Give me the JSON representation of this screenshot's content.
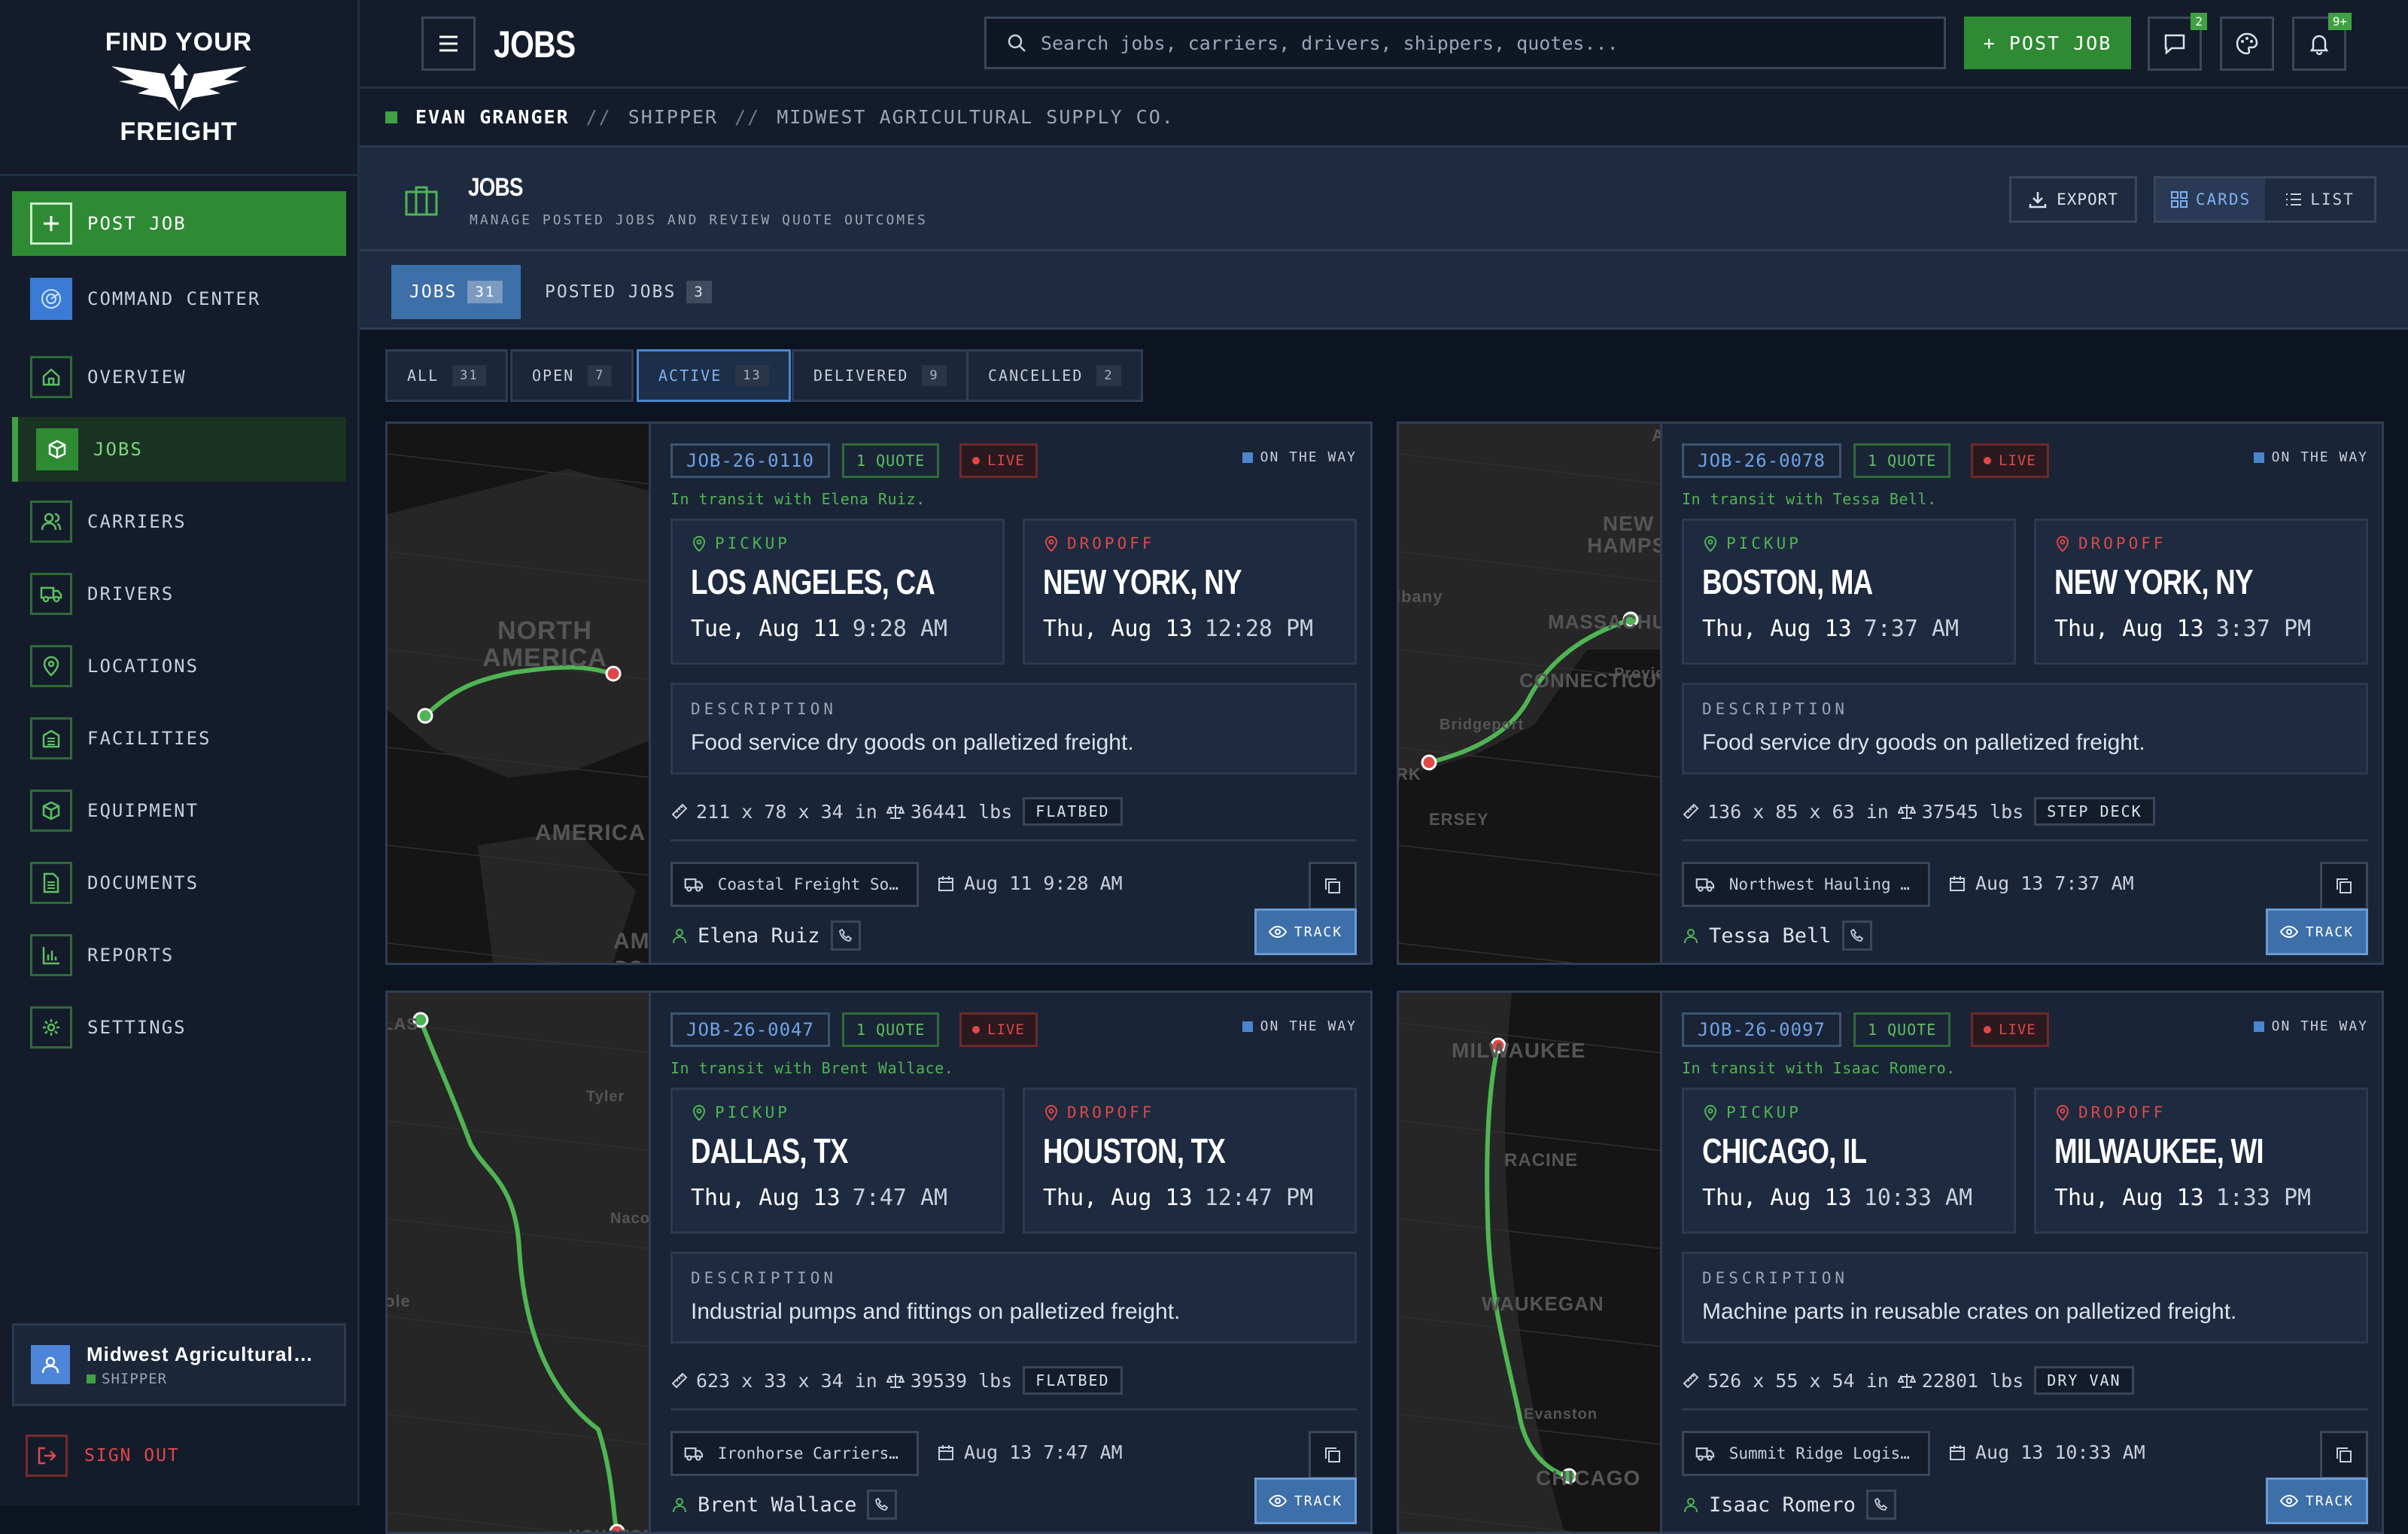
{
  "brand": {
    "line1": "FIND YOUR",
    "line2": "FREIGHT"
  },
  "sidebar": {
    "post_job": "POST JOB",
    "items": [
      {
        "label": "COMMAND CENTER",
        "icon": "radar-icon"
      },
      {
        "label": "OVERVIEW",
        "icon": "home-icon"
      },
      {
        "label": "JOBS",
        "icon": "box-icon"
      },
      {
        "label": "CARRIERS",
        "icon": "users-icon"
      },
      {
        "label": "DRIVERS",
        "icon": "truck-icon"
      },
      {
        "label": "LOCATIONS",
        "icon": "pin-icon"
      },
      {
        "label": "FACILITIES",
        "icon": "building-icon"
      },
      {
        "label": "EQUIPMENT",
        "icon": "cube-icon"
      },
      {
        "label": "DOCUMENTS",
        "icon": "document-icon"
      },
      {
        "label": "REPORTS",
        "icon": "bar-chart-icon"
      },
      {
        "label": "SETTINGS",
        "icon": "gear-icon"
      }
    ],
    "user": {
      "name": "Midwest Agricultural…",
      "role": "SHIPPER"
    },
    "sign_out": "SIGN OUT"
  },
  "topbar": {
    "title": "JOBS",
    "search_placeholder": "Search jobs, carriers, drivers, shippers, quotes...",
    "post_job": "+ POST JOB",
    "messages_badge": "2",
    "notifications_badge": "9+"
  },
  "breadcrumb": {
    "user": "EVAN GRANGER",
    "role": "SHIPPER",
    "company": "MIDWEST AGRICULTURAL SUPPLY CO.",
    "sep": "//"
  },
  "header": {
    "title": "JOBS",
    "subtitle": "MANAGE POSTED JOBS AND REVIEW QUOTE OUTCOMES",
    "export": "EXPORT",
    "view_cards": "CARDS",
    "view_list": "LIST"
  },
  "tabs": [
    {
      "label": "JOBS",
      "count": "31"
    },
    {
      "label": "POSTED JOBS",
      "count": "3"
    }
  ],
  "filters": [
    {
      "label": "ALL",
      "count": "31"
    },
    {
      "label": "OPEN",
      "count": "7"
    },
    {
      "label": "ACTIVE",
      "count": "13"
    },
    {
      "label": "DELIVERED",
      "count": "9"
    },
    {
      "label": "CANCELLED",
      "count": "2"
    }
  ],
  "labels": {
    "pickup": "PICKUP",
    "dropoff": "DROPOFF",
    "description": "DESCRIPTION",
    "track": "TRACK",
    "status": "ON THE WAY",
    "live": "LIVE"
  },
  "colors": {
    "accent_green": "#2f8a34",
    "accent_blue": "#3d6fa8",
    "live_red": "#e04848",
    "bg": "#0d1421"
  },
  "jobs": [
    {
      "id": "JOB-26-0110",
      "quotes": "1 QUOTE",
      "transit": "In transit with Elena Ruiz.",
      "pickup_city": "LOS ANGELES, CA",
      "pickup_date": "Tue, Aug 11",
      "pickup_time": "9:28 AM",
      "drop_city": "NEW YORK, NY",
      "drop_date": "Thu, Aug 13",
      "drop_time": "12:28 PM",
      "description": "Food service dry goods on palletized freight.",
      "dims": "211 x 78 x 34 in",
      "weight": "36441 lbs",
      "equipment": "FLATBED",
      "carrier": "Coastal Freight Sol…",
      "pickup_short": "Aug 11 9:28 AM",
      "driver": "Elena Ruiz",
      "map_labels": [
        "NORTH AMERICA",
        "AMERICA",
        "AM",
        "DO SU"
      ]
    },
    {
      "id": "JOB-26-0078",
      "quotes": "1 QUOTE",
      "transit": "In transit with Tessa Bell.",
      "pickup_city": "BOSTON, MA",
      "pickup_date": "Thu, Aug 13",
      "pickup_time": "7:37 AM",
      "drop_city": "NEW YORK, NY",
      "drop_date": "Thu, Aug 13",
      "drop_time": "3:37 PM",
      "description": "Food service dry goods on palletized freight.",
      "dims": "136 x 85 x 63 in",
      "weight": "37545 lbs",
      "equipment": "STEP DECK",
      "carrier": "Northwest Hauling G…",
      "pickup_short": "Aug 13 7:37 AM",
      "driver": "Tessa Bell",
      "map_labels": [
        "NEW HAMPSHIRE",
        "lbany",
        "MASSACHUSETTS",
        "CONNECTICUT",
        "Provid",
        "Bridgeport",
        "RK",
        "ERSEY",
        "A"
      ]
    },
    {
      "id": "JOB-26-0047",
      "quotes": "1 QUOTE",
      "transit": "In transit with Brent Wallace.",
      "pickup_city": "DALLAS, TX",
      "pickup_date": "Thu, Aug 13",
      "pickup_time": "7:47 AM",
      "drop_city": "HOUSTON, TX",
      "drop_date": "Thu, Aug 13",
      "drop_time": "12:47 PM",
      "description": "Industrial pumps and fittings on palletized freight.",
      "dims": "623 x 33 x 34 in",
      "weight": "39539 lbs",
      "equipment": "FLATBED",
      "carrier": "Ironhorse Carriers …",
      "pickup_short": "Aug 13 7:47 AM",
      "driver": "Brent Wallace",
      "map_labels": [
        "LAS",
        "Tyler",
        "Nacog",
        "ole",
        "HOUSTON"
      ]
    },
    {
      "id": "JOB-26-0097",
      "quotes": "1 QUOTE",
      "transit": "In transit with Isaac Romero.",
      "pickup_city": "CHICAGO, IL",
      "pickup_date": "Thu, Aug 13",
      "pickup_time": "10:33 AM",
      "drop_city": "MILWAUKEE, WI",
      "drop_date": "Thu, Aug 13",
      "drop_time": "1:33 PM",
      "description": "Machine parts in reusable crates on palletized freight.",
      "dims": "526 x 55 x 54 in",
      "weight": "22801 lbs",
      "equipment": "DRY VAN",
      "carrier": "Summit Ridge Logist…",
      "pickup_short": "Aug 13 10:33 AM",
      "driver": "Isaac Romero",
      "map_labels": [
        "MILWAUKEE",
        "RACINE",
        "WAUKEGAN",
        "Evanston",
        "CHICAGO"
      ]
    }
  ]
}
